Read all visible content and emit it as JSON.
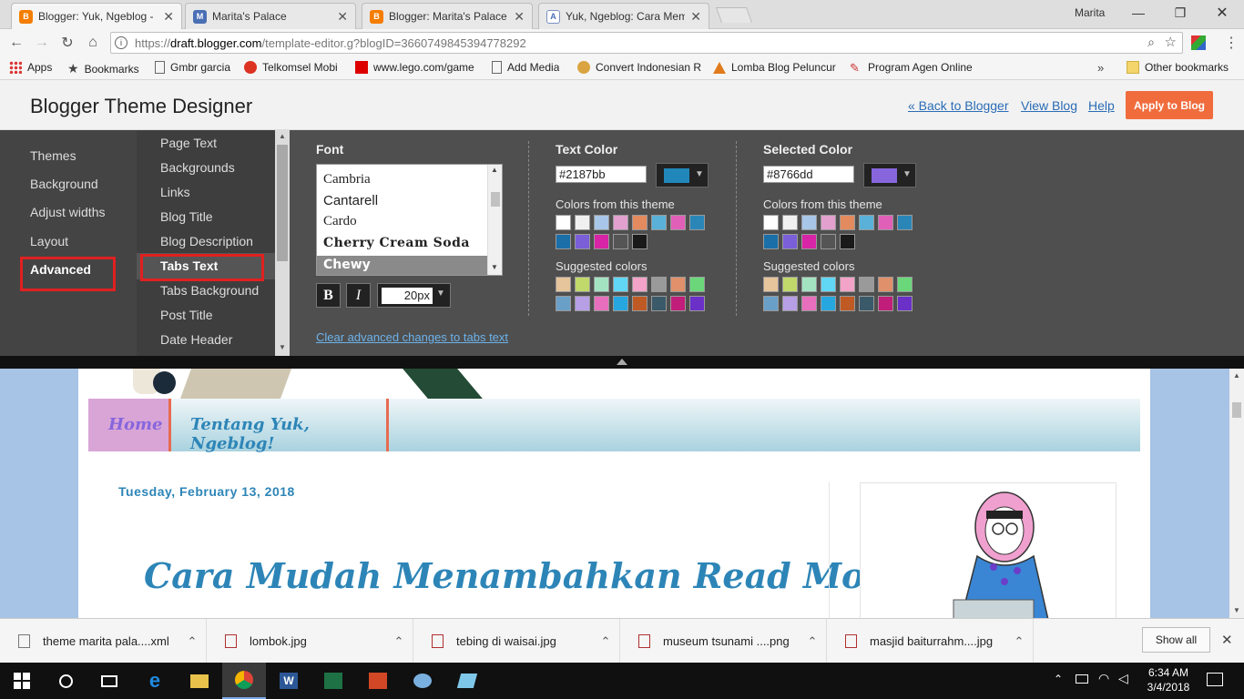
{
  "browser": {
    "tabs": [
      {
        "title": "Blogger: Yuk, Ngeblog - ",
        "icon": "blogger-icon",
        "active": true
      },
      {
        "title": "Marita's Palace",
        "icon": "m-icon",
        "active": false
      },
      {
        "title": "Blogger: Marita's Palace",
        "icon": "blogger-icon",
        "active": false
      },
      {
        "title": "Yuk, Ngeblog: Cara Mem",
        "icon": "yuk-icon",
        "active": false
      }
    ],
    "profile_name": "Marita",
    "url_prefix": "https://",
    "url_host": "draft.blogger.com",
    "url_path": "/template-editor.g?blogID=3660749845394778292",
    "bookmarks": [
      "Apps",
      "Bookmarks",
      "Gmbr garcia",
      "Telkomsel Mobi",
      "www.lego.com/game",
      "Add Media",
      "Convert Indonesian R",
      "Lomba Blog Peluncur",
      "Program Agen Online"
    ],
    "other_bookmarks": "Other bookmarks",
    "overflow": "»"
  },
  "designer": {
    "title": "Blogger Theme Designer",
    "links": {
      "back": "« Back to Blogger",
      "view": "View Blog",
      "help": "Help"
    },
    "apply_label": "Apply to Blog",
    "nav_primary": [
      "Themes",
      "Background",
      "Adjust widths",
      "Layout",
      "Advanced"
    ],
    "nav_secondary": [
      "Page Text",
      "Backgrounds",
      "Links",
      "Blog Title",
      "Blog Description",
      "Tabs Text",
      "Tabs Background",
      "Post Title",
      "Date Header"
    ],
    "selected_primary": "Advanced",
    "selected_secondary": "Tabs Text",
    "font": {
      "label": "Font",
      "options": [
        "Cambria",
        "Cantarell",
        "Cardo",
        "Cherry Cream Soda",
        "Chewy"
      ],
      "selected": "Chewy",
      "bold_label": "B",
      "italic_label": "I",
      "size": "20px"
    },
    "text_color": {
      "label": "Text Color",
      "hex": "#2187bb",
      "theme_label": "Colors from this theme",
      "suggested_label": "Suggested colors"
    },
    "selected_color": {
      "label": "Selected Color",
      "hex": "#8766dd",
      "theme_label": "Colors from this theme",
      "suggested_label": "Suggested colors"
    },
    "theme_colors": [
      "#ffffff",
      "#f0f0f0",
      "#a8c6e8",
      "#e2a0cf",
      "#e38a5e",
      "#5ab1d8",
      "#e060b8",
      "#2b86b8",
      "#1a6fa8",
      "#7a5fd8",
      "#d824a6",
      "#555555",
      "#1a1a1a"
    ],
    "suggested_colors": [
      "#e6c49c",
      "#c1d86a",
      "#a3e3c2",
      "#62d6f5",
      "#f3a2c8",
      "#9a9a9a",
      "#e0906a",
      "#6ad87a",
      "#6aa0c8",
      "#b79fe6",
      "#e86fbd",
      "#26a7e0",
      "#c05a24",
      "#3a5a6a",
      "#c01e7a",
      "#6a30c8"
    ],
    "clear_link": "Clear advanced changes to tabs text"
  },
  "preview": {
    "tabs": [
      "Home",
      "Tentang Yuk, Ngeblog!"
    ],
    "date": "Tuesday, February 13, 2018",
    "post_title": "Cara Mudah Menambahkan Read More"
  },
  "downloads": {
    "items": [
      "theme marita pala....xml",
      "lombok.jpg",
      "tebing di waisai.jpg",
      "museum tsunami ....png",
      "masjid baiturrahm....jpg"
    ],
    "show_all": "Show all"
  },
  "taskbar": {
    "time": "6:34 AM",
    "date": "3/4/2018"
  }
}
